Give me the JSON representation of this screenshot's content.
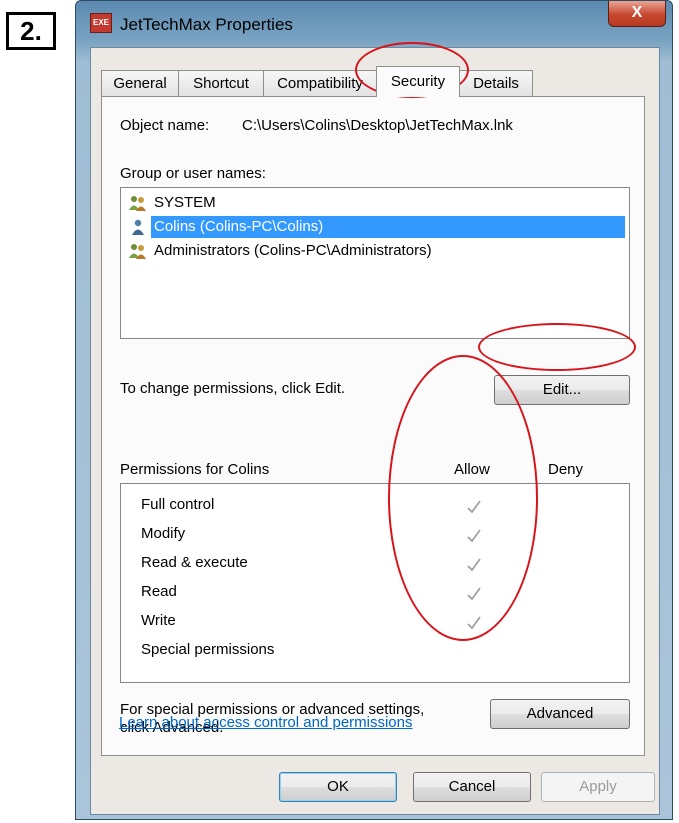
{
  "step_label": "2.",
  "window": {
    "title": "JetTechMax Properties",
    "close_label": "X",
    "icon_name": "app-icon"
  },
  "tabs": [
    {
      "label": "General"
    },
    {
      "label": "Shortcut"
    },
    {
      "label": "Compatibility"
    },
    {
      "label": "Security",
      "active": true
    },
    {
      "label": "Details"
    }
  ],
  "security": {
    "object_name_label": "Object name:",
    "object_name_value": "C:\\Users\\Colins\\Desktop\\JetTechMax.lnk",
    "group_label": "Group or user names:",
    "users": [
      {
        "name": "SYSTEM",
        "icon": "group-users-icon"
      },
      {
        "name": "Colins (Colins-PC\\Colins)",
        "icon": "user-icon",
        "selected": true
      },
      {
        "name": "Administrators (Colins-PC\\Administrators)",
        "icon": "group-users-icon"
      }
    ],
    "change_hint": "To change permissions, click Edit.",
    "edit_button": "Edit...",
    "permissions_for": "Permissions for Colins",
    "allow_header": "Allow",
    "deny_header": "Deny",
    "permissions": [
      {
        "name": "Full control",
        "allow": true,
        "deny": false
      },
      {
        "name": "Modify",
        "allow": true,
        "deny": false
      },
      {
        "name": "Read & execute",
        "allow": true,
        "deny": false
      },
      {
        "name": "Read",
        "allow": true,
        "deny": false
      },
      {
        "name": "Write",
        "allow": true,
        "deny": false
      },
      {
        "name": "Special permissions",
        "allow": false,
        "deny": false
      }
    ],
    "special_hint_line1": "For special permissions or advanced settings,",
    "special_hint_line2": "click Advanced.",
    "advanced_button": "Advanced",
    "learn_link": "Learn about access control and permissions"
  },
  "footer": {
    "ok": "OK",
    "cancel": "Cancel",
    "apply": "Apply"
  },
  "colors": {
    "selection": "#3399ff",
    "annotation": "#d8141a",
    "link": "#0066cc",
    "check": "#a0a0a0"
  }
}
